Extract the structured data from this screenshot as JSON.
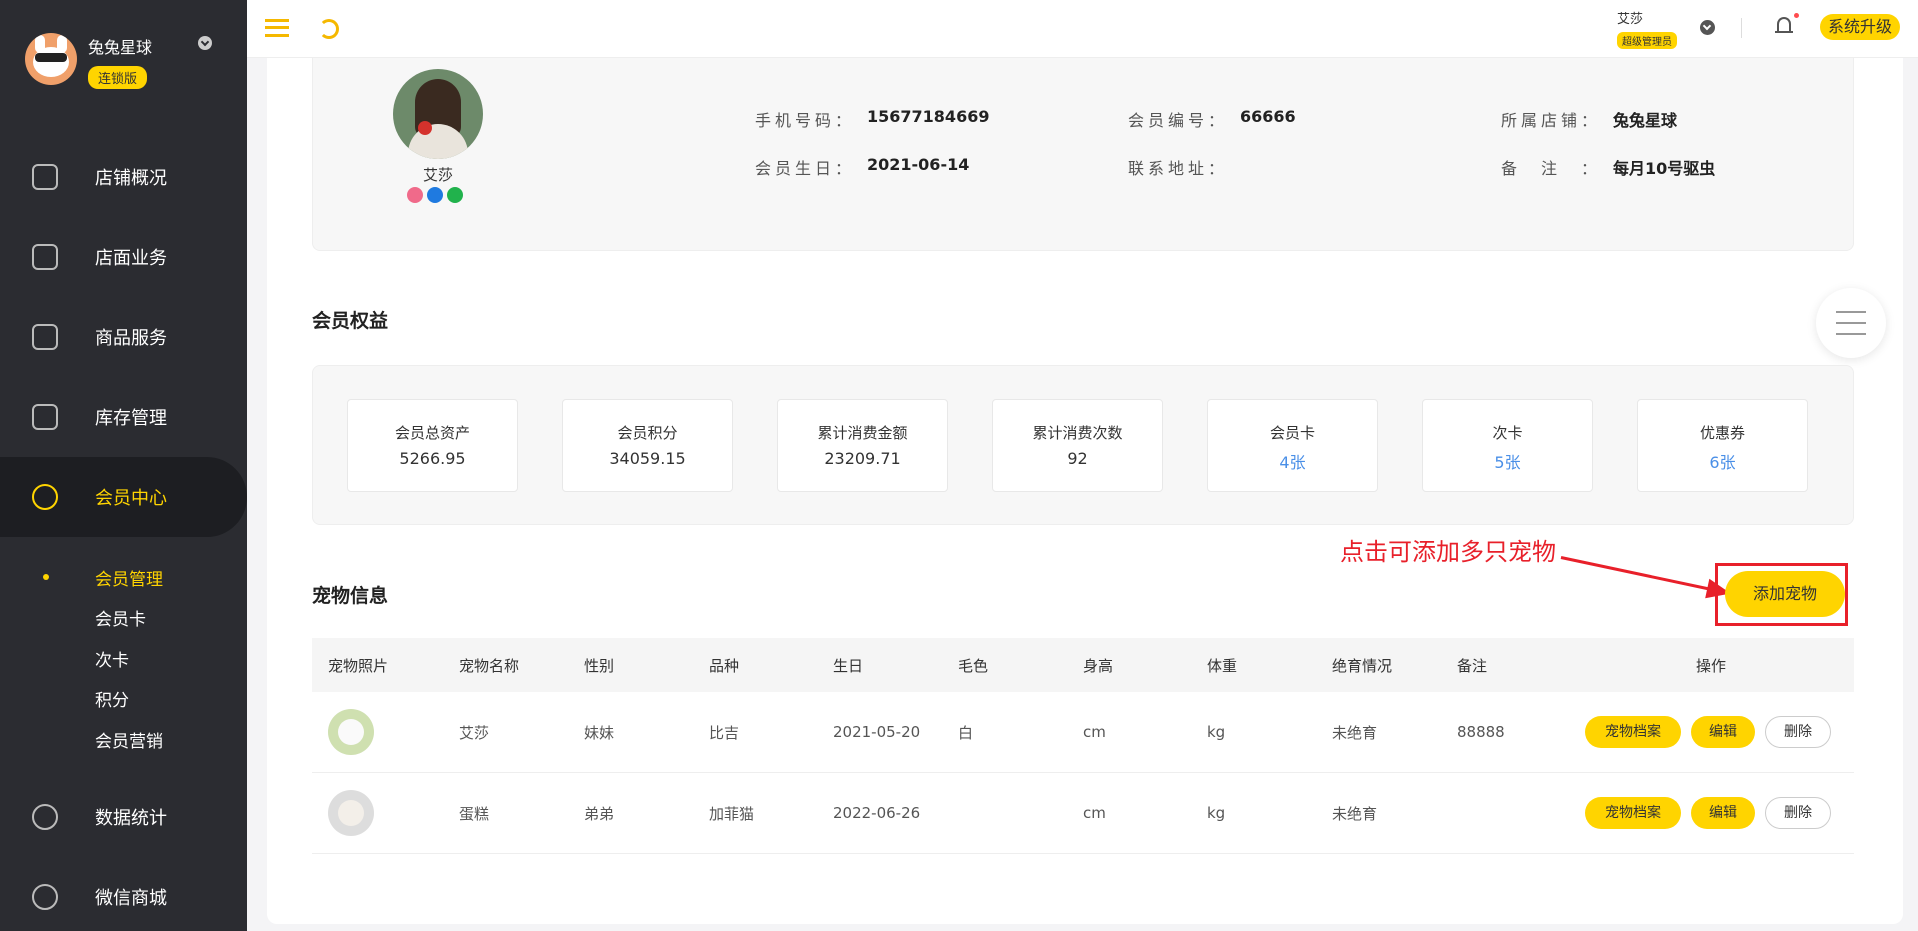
{
  "sidebar": {
    "brand_name": "兔兔星球",
    "brand_badge": "连锁版",
    "items": [
      {
        "label": "店铺概况",
        "icon": "dashboard-icon"
      },
      {
        "label": "店面业务",
        "icon": "store-icon"
      },
      {
        "label": "商品服务",
        "icon": "bag-icon"
      },
      {
        "label": "库存管理",
        "icon": "inventory-icon"
      },
      {
        "label": "会员中心",
        "icon": "member-icon"
      },
      {
        "label": "数据统计",
        "icon": "chart-icon"
      },
      {
        "label": "微信商城",
        "icon": "wechat-icon"
      }
    ],
    "sub_items": [
      {
        "label": "会员管理"
      },
      {
        "label": "会员卡"
      },
      {
        "label": "次卡"
      },
      {
        "label": "积分"
      },
      {
        "label": "会员营销"
      }
    ]
  },
  "topbar": {
    "user_name": "艾莎",
    "user_role": "超级管理员",
    "upgrade_label": "系统升级"
  },
  "profile": {
    "name": "艾莎",
    "fields": [
      {
        "label": "手机号码：",
        "value": "15677184669"
      },
      {
        "label": "会员编号：",
        "value": "66666"
      },
      {
        "label": "所属店铺：",
        "value": "兔兔星球"
      },
      {
        "label": "会员生日：",
        "value": "2021-06-14"
      },
      {
        "label": "联系地址：",
        "value": ""
      },
      {
        "label": "备　注　：",
        "value": "每月10号驱虫"
      }
    ]
  },
  "rights": {
    "title": "会员权益",
    "cards": [
      {
        "title": "会员总资产",
        "value": "5266.95"
      },
      {
        "title": "会员积分",
        "value": "34059.15"
      },
      {
        "title": "累计消费金额",
        "value": "23209.71"
      },
      {
        "title": "累计消费次数",
        "value": "92"
      },
      {
        "title": "会员卡",
        "value": "4张"
      },
      {
        "title": "次卡",
        "value": "5张"
      },
      {
        "title": "优惠券",
        "value": "6张"
      }
    ]
  },
  "pets": {
    "title": "宠物信息",
    "add_label": "添加宠物",
    "annotation": "点击可添加多只宠物",
    "columns": [
      "宠物照片",
      "宠物名称",
      "性别",
      "品种",
      "生日",
      "毛色",
      "身高",
      "体重",
      "绝育情况",
      "备注",
      "操作"
    ],
    "rows": [
      {
        "name": "艾莎",
        "gender": "妹妹",
        "breed": "比吉",
        "birthday": "2021-05-20",
        "color": "白",
        "height": "cm",
        "weight": "kg",
        "neuter": "未绝育",
        "note": "88888"
      },
      {
        "name": "蛋糕",
        "gender": "弟弟",
        "breed": "加菲猫",
        "birthday": "2022-06-26",
        "color": "",
        "height": "cm",
        "weight": "kg",
        "neuter": "未绝育",
        "note": ""
      }
    ],
    "actions": {
      "archive": "宠物档案",
      "edit": "编辑",
      "delete": "删除"
    }
  }
}
